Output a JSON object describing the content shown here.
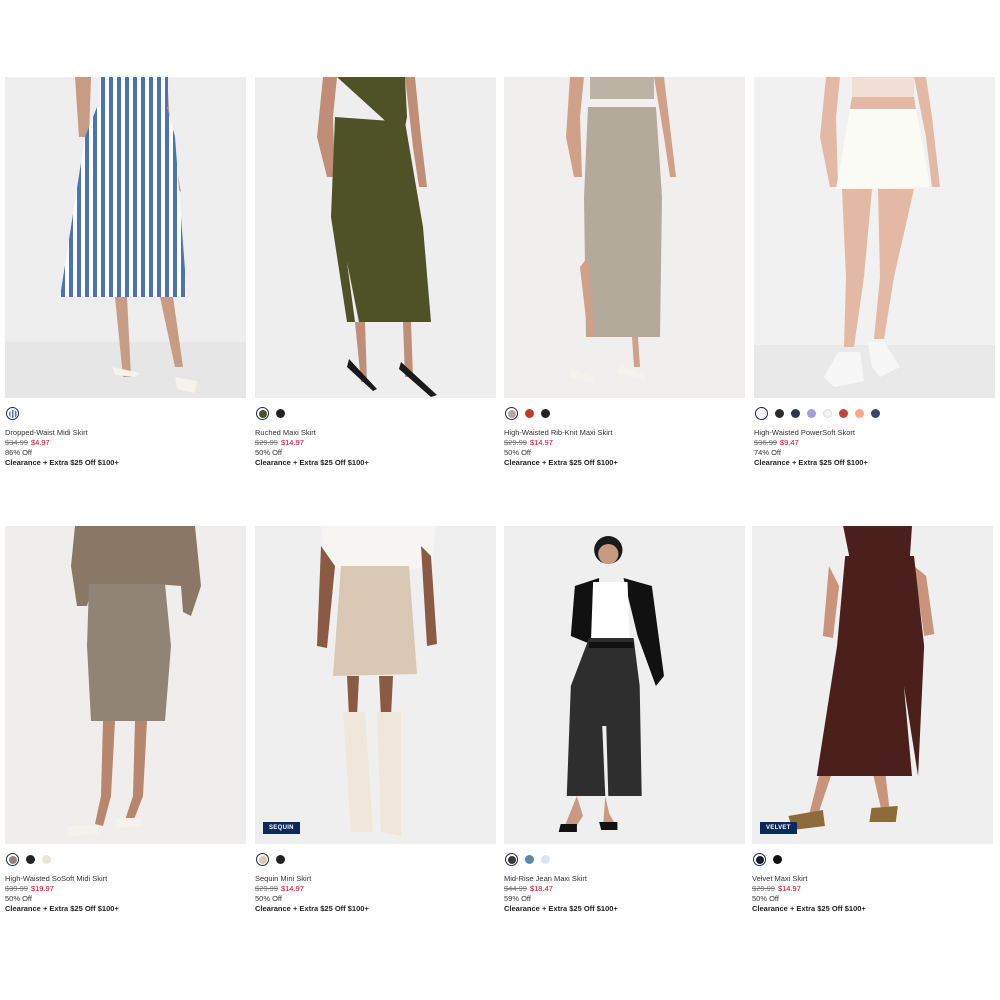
{
  "products": [
    {
      "name": "Dropped-Waist Midi Skirt",
      "orig_price": "$34.99",
      "sale_price": "$4.97",
      "discount": "86% Off",
      "promo": "Clearance + Extra $25 Off $100+",
      "badge": "",
      "swatches": [
        "#4a73b8"
      ]
    },
    {
      "name": "Ruched Maxi Skirt",
      "orig_price": "$29.99",
      "sale_price": "$14.97",
      "discount": "50% Off",
      "promo": "Clearance + Extra $25 Off $100+",
      "badge": "",
      "swatches": [
        "#4e5226",
        "#222222"
      ]
    },
    {
      "name": "High-Waisted Rib-Knit Maxi Skirt",
      "orig_price": "$29.99",
      "sale_price": "$14.97",
      "discount": "50% Off",
      "promo": "Clearance + Extra $25 Off $100+",
      "badge": "",
      "swatches": [
        "#b3aa9c",
        "#c0392b",
        "#222222"
      ]
    },
    {
      "name": "High-Waisted PowerSoft Skort",
      "orig_price": "$36.99",
      "sale_price": "$9.47",
      "discount": "74% Off",
      "promo": "Clearance + Extra $25 Off $100+",
      "badge": "",
      "swatches": [
        "#f4f4f4",
        "#2b2b2b",
        "#2e3550",
        "#a3a0d8",
        "#f2f2f2",
        "#c0483a",
        "#f5a98a",
        "#3a4568"
      ]
    },
    {
      "name": "High-Waisted SoSoft Midi Skirt",
      "orig_price": "$39.99",
      "sale_price": "$19.97",
      "discount": "50% Off",
      "promo": "Clearance + Extra $25 Off $100+",
      "badge": "",
      "swatches": [
        "#8f8476",
        "#222222",
        "#ebe4d8"
      ]
    },
    {
      "name": "Sequin Mini Skirt",
      "orig_price": "$29.99",
      "sale_price": "$14.97",
      "discount": "50% Off",
      "promo": "Clearance + Extra $25 Off $100+",
      "badge": "SEQUIN",
      "swatches": [
        "#d9c9b4",
        "#222222"
      ]
    },
    {
      "name": "Mid-Rise Jean Maxi Skirt",
      "orig_price": "$44.99",
      "sale_price": "$18.47",
      "discount": "59% Off",
      "promo": "Clearance + Extra $25 Off $100+",
      "badge": "",
      "swatches": [
        "#3a3a3a",
        "#5b8aa6",
        "#d7e6ef"
      ]
    },
    {
      "name": "Velvet Maxi Skirt",
      "orig_price": "$29.99",
      "sale_price": "$14.97",
      "discount": "50% Off",
      "promo": "Clearance + Extra $25 Off $100+",
      "badge": "VELVET",
      "swatches": [
        "#1c1c28",
        "#111111"
      ]
    }
  ],
  "colors": {
    "sale_red": "#d0021b",
    "badge_navy": "#0b2a5a"
  }
}
